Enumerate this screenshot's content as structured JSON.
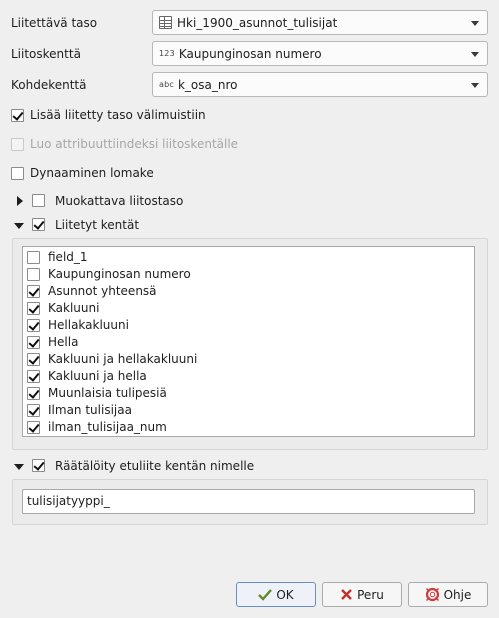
{
  "fields": {
    "joined_layer_label": "Liitettävä taso",
    "joined_layer_value": "Hki_1900_asunnot_tulisijat",
    "join_field_label": "Liitoskenttä",
    "join_field_type": "123",
    "join_field_value": "Kaupunginosan numero",
    "target_field_label": "Kohdekenttä",
    "target_field_type": "abc",
    "target_field_value": "k_osa_nro"
  },
  "options": {
    "cache_label": "Lisää liitetty taso välimuistiin",
    "cache_checked": true,
    "index_label": "Luo attribuuttiindeksi liitoskentälle",
    "index_checked": false,
    "dynamic_form_label": "Dynaaminen lomake",
    "dynamic_form_checked": false
  },
  "editable_group": {
    "label": "Muokattava liitostaso",
    "expanded": false,
    "checked": false
  },
  "joined_fields_group": {
    "label": "Liitetyt kentät",
    "expanded": true,
    "checked": true,
    "items": [
      {
        "label": "field_1",
        "checked": false
      },
      {
        "label": "Kaupunginosan numero",
        "checked": false
      },
      {
        "label": "Asunnot yhteensä",
        "checked": true
      },
      {
        "label": "Kakluuni",
        "checked": true
      },
      {
        "label": "Hellakakluuni",
        "checked": true
      },
      {
        "label": "Hella",
        "checked": true
      },
      {
        "label": "Kakluuni ja hellakakluuni",
        "checked": true
      },
      {
        "label": "Kakluuni ja hella",
        "checked": true
      },
      {
        "label": "Muunlaisia tulipesiä",
        "checked": true
      },
      {
        "label": "Ilman tulisijaa",
        "checked": true
      },
      {
        "label": "ilman_tulisijaa_num",
        "checked": true
      }
    ]
  },
  "prefix_group": {
    "label": "Räätälöity etuliite kentän nimelle",
    "expanded": true,
    "checked": true,
    "value": "tulisijatyyppi_"
  },
  "buttons": {
    "ok": "OK",
    "cancel": "Peru",
    "help": "Ohje"
  },
  "colors": {
    "ok_icon": "#5a8a2e",
    "cancel_icon": "#c0302c",
    "help_icon": "#d03a3a"
  }
}
